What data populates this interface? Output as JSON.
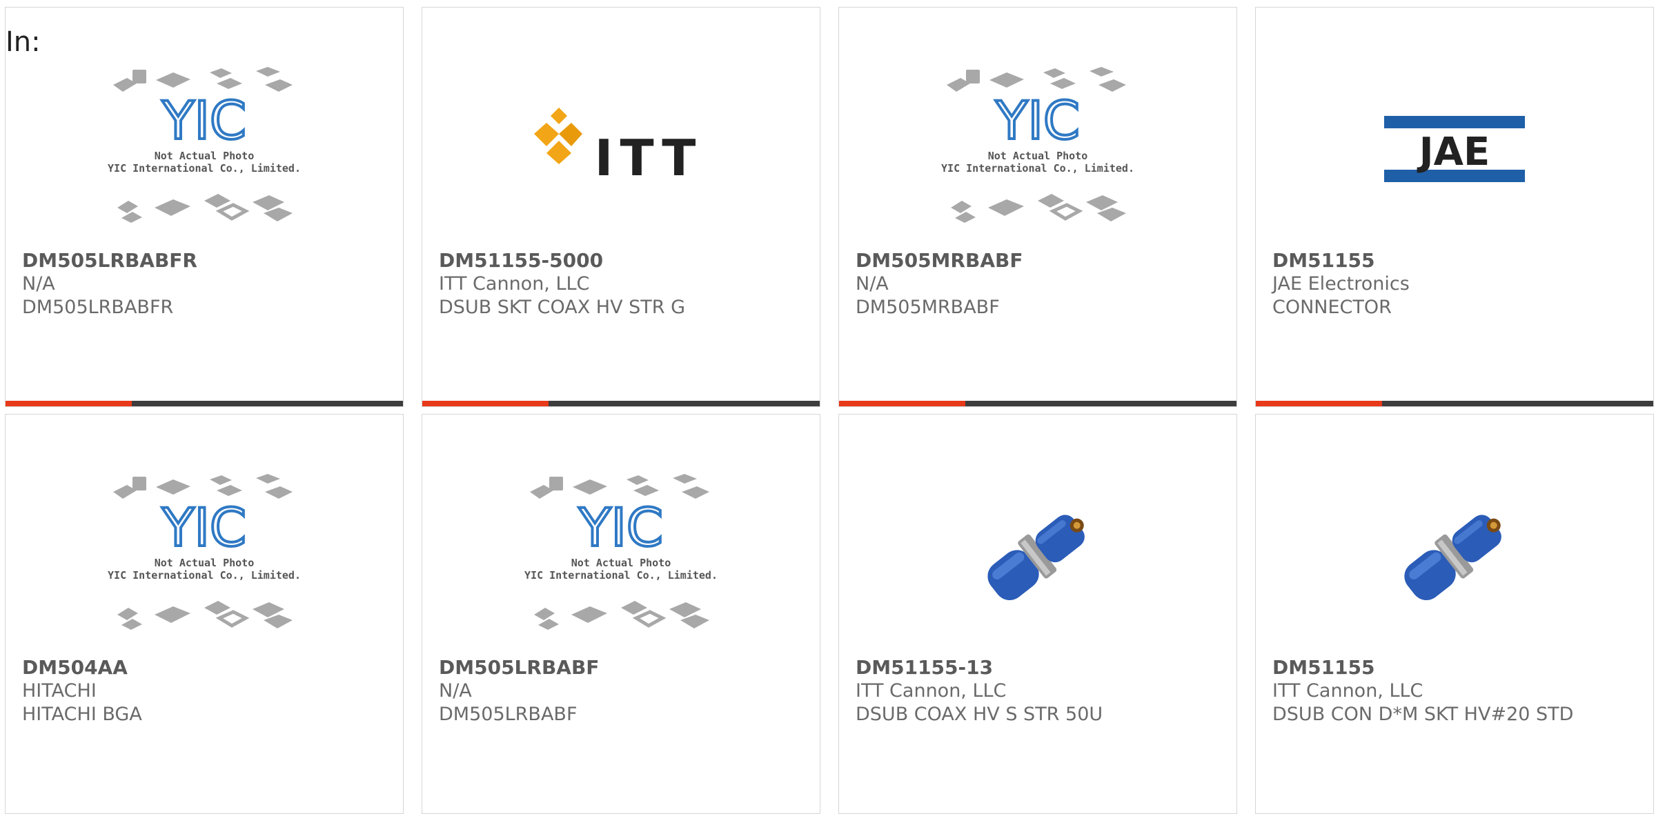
{
  "header": {
    "in_label": "In:"
  },
  "colors": {
    "accent": "#e8391a",
    "bar": "#3d3d3d",
    "yic_blue": "#2f79c4",
    "jae_blue": "#1f5fa8",
    "itt_orange": "#f2a516",
    "connector_blue": "#2b5cb8"
  },
  "products": [
    {
      "part_number": "DM505LRBABFR",
      "manufacturer": "N/A",
      "description": "DM505LRBABFR",
      "image": "yic-placeholder",
      "placeholder_line1": "Not Actual Photo",
      "placeholder_line2": "YIC International Co., Limited."
    },
    {
      "part_number": "DM51155-5000",
      "manufacturer": "ITT Cannon, LLC",
      "description": "DSUB SKT COAX HV STR G",
      "image": "itt-logo",
      "logo_text": "ITT"
    },
    {
      "part_number": "DM505MRBABF",
      "manufacturer": "N/A",
      "description": "DM505MRBABF",
      "image": "yic-placeholder",
      "placeholder_line1": "Not Actual Photo",
      "placeholder_line2": "YIC International Co., Limited."
    },
    {
      "part_number": "DM51155",
      "manufacturer": "JAE Electronics",
      "description": "CONNECTOR",
      "image": "jae-logo",
      "logo_text": "JAE"
    },
    {
      "part_number": "DM504AA",
      "manufacturer": "HITACHI",
      "description": "HITACHI BGA",
      "image": "yic-placeholder",
      "placeholder_line1": "Not Actual Photo",
      "placeholder_line2": "YIC International Co., Limited."
    },
    {
      "part_number": "DM505LRBABF",
      "manufacturer": "N/A",
      "description": "DM505LRBABF",
      "image": "yic-placeholder",
      "placeholder_line1": "Not Actual Photo",
      "placeholder_line2": "YIC International Co., Limited."
    },
    {
      "part_number": "DM51155-13",
      "manufacturer": "ITT Cannon, LLC",
      "description": "DSUB COAX HV S STR 50U",
      "image": "blue-connector-photo"
    },
    {
      "part_number": "DM51155",
      "manufacturer": "ITT Cannon, LLC",
      "description": "DSUB CON D*M SKT HV#20 STD",
      "image": "blue-connector-photo"
    }
  ]
}
